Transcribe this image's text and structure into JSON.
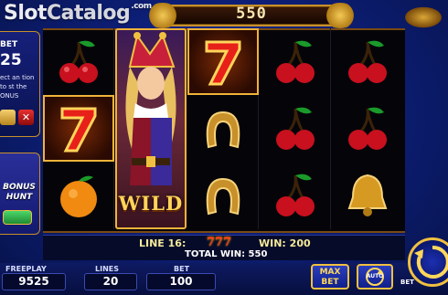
{
  "watermark": {
    "slot": "Slot",
    "catalog": "Catalog",
    "suffix": ".com"
  },
  "top_counter": "550",
  "left_panel": {
    "bet_label": "BET",
    "bet_value": "25",
    "description": "ect an tion to st the ONUS",
    "close_glyph": "✕"
  },
  "bonus_hunt": {
    "line1": "BONUS",
    "line2": "HUNT"
  },
  "reels": [
    [
      "cherry",
      "seven",
      "orange"
    ],
    [
      "wild",
      "wild",
      "wild"
    ],
    [
      "seven",
      "horseshoe",
      "horseshoe"
    ],
    [
      "cherry",
      "cherry",
      "cherry"
    ],
    [
      "cherry",
      "cherry",
      "bell"
    ]
  ],
  "wild_label": "WILD",
  "win": {
    "line_label": "LINE 16:",
    "symbols": "777",
    "win_label": "WIN: 200",
    "total_label": "TOTAL WIN: 550"
  },
  "bottom": {
    "freeplay_label": "FREEPLAY",
    "freeplay_value": "9525",
    "lines_label": "LINES",
    "lines_value": "20",
    "bet_label": "BET",
    "bet_value": "100",
    "maxbet_line1": "MAX",
    "maxbet_line2": "BET",
    "auto_label": "AUTO",
    "side_bet_label": "BET"
  },
  "colors": {
    "gold": "#f0c040",
    "cherry": "#c8101e",
    "seven": "#e8201a"
  }
}
